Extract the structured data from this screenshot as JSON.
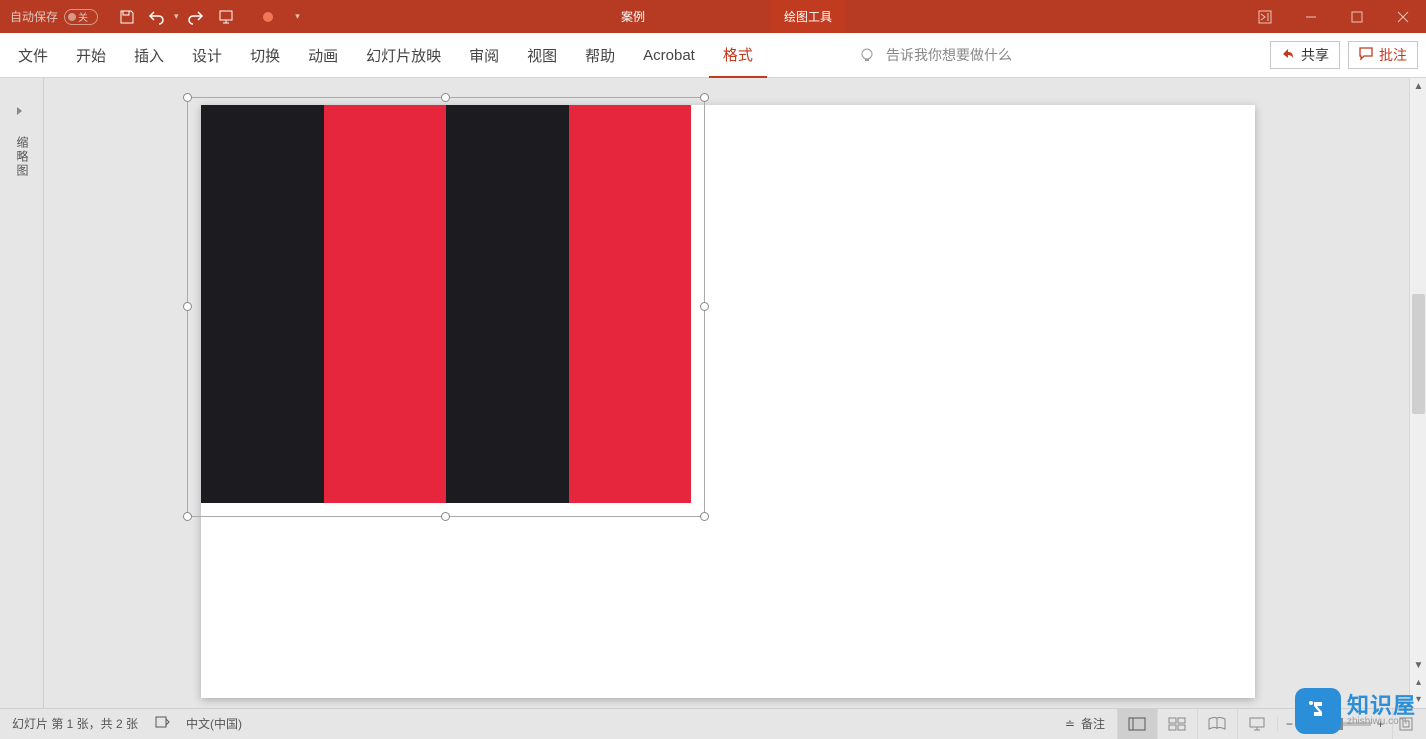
{
  "titlebar": {
    "autosave_label": "自动保存",
    "autosave_state": "关",
    "doc_title": "案例",
    "context_tool": "绘图工具"
  },
  "ribbon": {
    "tabs": [
      "文件",
      "开始",
      "插入",
      "设计",
      "切换",
      "动画",
      "幻灯片放映",
      "审阅",
      "视图",
      "帮助",
      "Acrobat",
      "格式"
    ],
    "active_tab": "格式",
    "tellme_placeholder": "告诉我你想要做什么",
    "share_label": "共享",
    "annotate_label": "批注"
  },
  "panel": {
    "vertical_label": "缩略图"
  },
  "statusbar": {
    "slide_info": "幻灯片 第 1 张，共 2 张",
    "language": "中文(中国)",
    "notes_label": "备注"
  },
  "watermark": {
    "brand": "知识屋",
    "domain": "zhishiwu.com"
  }
}
